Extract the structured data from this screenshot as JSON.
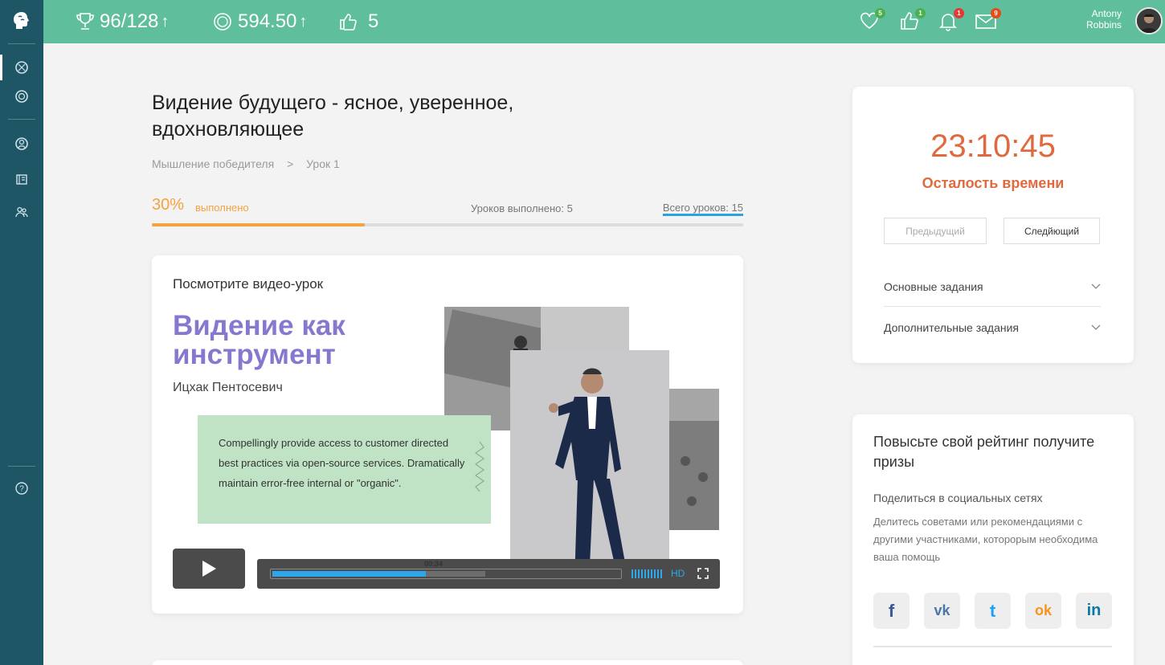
{
  "topbar": {
    "trophies": "96/128",
    "trophies_arrow": "↑",
    "points": "594.50",
    "points_arrow": "↑",
    "likes": "5",
    "notifications": [
      {
        "icon": "heart-icon",
        "count": "5",
        "color": "#4caf50"
      },
      {
        "icon": "thumbs-up-icon",
        "count": "1",
        "color": "#4caf50"
      },
      {
        "icon": "bell-icon",
        "count": "1",
        "color": "#e53935"
      },
      {
        "icon": "envelope-icon",
        "count": "9",
        "color": "#e64a19"
      }
    ],
    "user_first": "Antony",
    "user_last": "Robbins"
  },
  "lesson": {
    "title": "Видение будущего - ясное, уверенное, вдохновляющее",
    "breadcrumb_course": "Мышление победителя",
    "breadcrumb_sep": ">",
    "breadcrumb_lesson": "Урок 1",
    "percent": "30%",
    "percent_label": "выполнено",
    "progress_fraction": 0.36,
    "lessons_done": "Уроков выполнено: 5",
    "lessons_total": "Всего уроков: 15"
  },
  "video": {
    "heading": "Посмотрите видео-урок",
    "title": "Видение как инструмент",
    "author": "Ицхак Пентосевич",
    "quote": "Compellingly provide access to customer directed best practices via open-source services. Dramatically maintain error-free internal or \"organic\".",
    "current_time": "00:34",
    "played_fraction": 0.44,
    "buffered_fraction": 0.61,
    "quality": "HD"
  },
  "timer": {
    "time": "23:10:45",
    "label": "Осталость времени",
    "prev_label": "Предыдущий",
    "next_label": "Следйющий",
    "accordion": [
      "Основные задания",
      "Дополнительные задания"
    ]
  },
  "rating": {
    "title": "Повысьте свой рейтинг получите призы",
    "share_title": "Поделиться в социальных сетях",
    "share_desc": "Делитесь советами или рекомендациями с другими участниками, которорым необходима ваша помощь",
    "socials": [
      {
        "name": "facebook",
        "glyph": "f",
        "color": "#3b5998"
      },
      {
        "name": "vk",
        "glyph": "vk",
        "color": "#4a76a8"
      },
      {
        "name": "twitter",
        "glyph": "t",
        "color": "#1da1f2"
      },
      {
        "name": "odnoklassniki",
        "glyph": "ok",
        "color": "#f7931e"
      },
      {
        "name": "linkedin",
        "glyph": "in",
        "color": "#0e76a8"
      }
    ]
  },
  "colors": {
    "sidebar": "#1f5666",
    "topbar": "#5fbf9c",
    "accent_orange": "#f4a340",
    "accent_blue": "#2ca2e3",
    "timer_orange": "#e06a3f",
    "title_purple": "#8778cf"
  }
}
